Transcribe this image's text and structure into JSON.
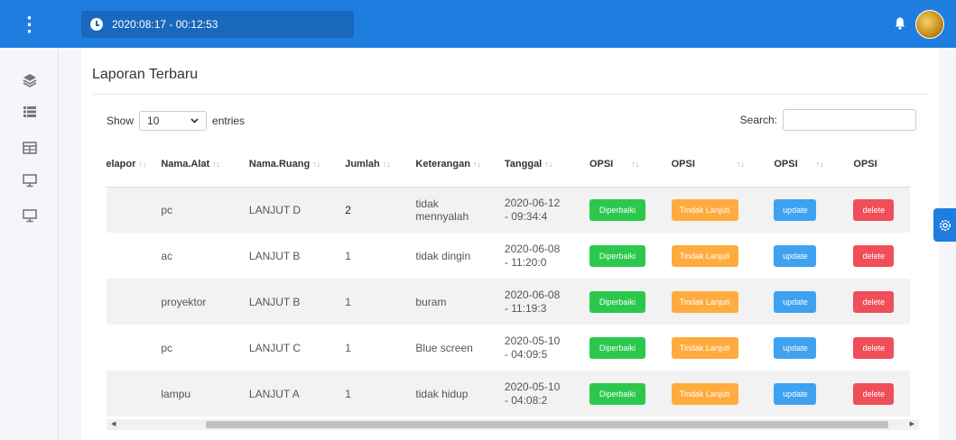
{
  "header": {
    "datetime": "2020:08:17 - 00:12:53"
  },
  "card": {
    "title": "Laporan Terbaru"
  },
  "controls": {
    "show_label": "Show",
    "entries_value": "10",
    "entries_label": "entries",
    "search_label": "Search:"
  },
  "table": {
    "columns": [
      "Pelapor",
      "Nama.Alat",
      "Nama.Ruang",
      "Jumlah",
      "Keterangan",
      "Tanggal",
      "OPSI",
      "OPSI",
      "OPSI",
      "OPSI"
    ],
    "rows": [
      {
        "nama_alat": "pc",
        "nama_ruang": "LANJUT D",
        "jumlah": "2",
        "keterangan": "tidak mennyalah",
        "tanggal": "2020-06-12 - 09:34:4"
      },
      {
        "nama_alat": "ac",
        "nama_ruang": "LANJUT B",
        "jumlah": "1",
        "keterangan": "tidak dingin",
        "tanggal": "2020-06-08 - 11:20:0"
      },
      {
        "nama_alat": "proyektor",
        "nama_ruang": "LANJUT B",
        "jumlah": "1",
        "keterangan": "buram",
        "tanggal": "2020-06-08 - 11:19:3"
      },
      {
        "nama_alat": "pc",
        "nama_ruang": "LANJUT C",
        "jumlah": "1",
        "keterangan": "Blue screen",
        "tanggal": "2020-05-10 - 04:09:5"
      },
      {
        "nama_alat": "lampu",
        "nama_ruang": "LANJUT A",
        "jumlah": "1",
        "keterangan": "tidak hidup",
        "tanggal": "2020-05-10 - 04:08:2"
      }
    ],
    "buttons": {
      "diperbaiki": "Diperbaiki",
      "tindak_lanjuti": "Tindak Lanjuti",
      "update": "update",
      "delete": "delete"
    }
  },
  "icons": {
    "menu": "kebab-menu-icon",
    "clock": "clock-icon",
    "bell": "bell-icon",
    "sidebar": [
      "layers-icon",
      "list-icon",
      "table-icon",
      "monitor-icon",
      "monitor-icon"
    ],
    "settings": "gear-icon"
  },
  "colors": {
    "primary": "#1f7de0",
    "green": "#2cc84d",
    "orange": "#ffab3e",
    "blue": "#3ea2f0",
    "red": "#f04f5a"
  }
}
